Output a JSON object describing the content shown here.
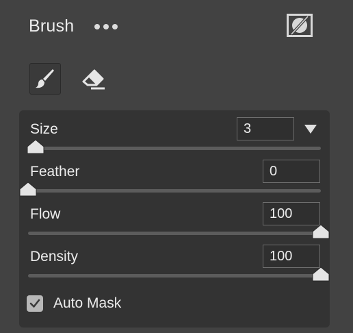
{
  "panel": {
    "title": "Brush"
  },
  "tools": {
    "brush_icon": "brush-icon",
    "eraser_icon": "eraser-icon",
    "mask_icon": "mask-visibility-icon",
    "more_icon": "more-options-icon"
  },
  "settings": {
    "size": {
      "label": "Size",
      "value": "3",
      "slider_fraction": 0.025
    },
    "feather": {
      "label": "Feather",
      "value": "0",
      "slider_fraction": 0.0
    },
    "flow": {
      "label": "Flow",
      "value": "100",
      "slider_fraction": 1.0
    },
    "density": {
      "label": "Density",
      "value": "100",
      "slider_fraction": 1.0
    }
  },
  "auto_mask": {
    "label": "Auto Mask",
    "checked": true
  },
  "colors": {
    "panel_bg": "#424242",
    "group_bg": "#333333",
    "text": "#ececec"
  }
}
